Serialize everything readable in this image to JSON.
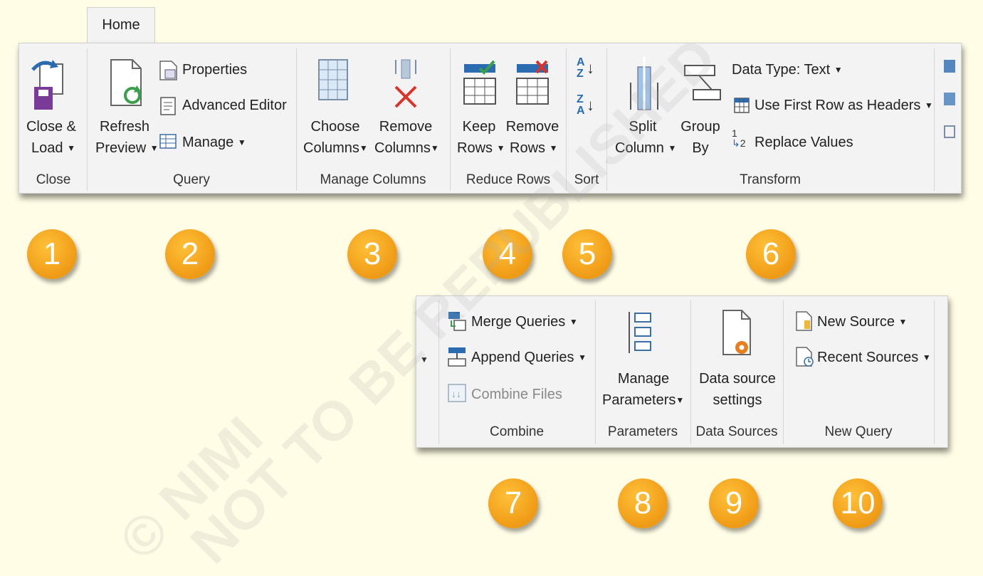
{
  "tab": {
    "label": "Home"
  },
  "close_group": {
    "close_load": [
      "Close &",
      "Load"
    ],
    "label": "Close"
  },
  "query_group": {
    "refresh_preview": [
      "Refresh",
      "Preview"
    ],
    "properties": "Properties",
    "advanced_editor": "Advanced Editor",
    "manage": "Manage",
    "label": "Query"
  },
  "manage_columns_group": {
    "choose_columns": [
      "Choose",
      "Columns"
    ],
    "remove_columns": [
      "Remove",
      "Columns"
    ],
    "label": "Manage Columns"
  },
  "reduce_rows_group": {
    "keep_rows": [
      "Keep",
      "Rows"
    ],
    "remove_rows": [
      "Remove",
      "Rows"
    ],
    "label": "Reduce Rows"
  },
  "sort_group": {
    "label": "Sort"
  },
  "transform_group": {
    "split_column": [
      "Split",
      "Column"
    ],
    "group_by": [
      "Group",
      "By"
    ],
    "data_type": "Data Type: Text",
    "use_first_row": "Use First Row as Headers",
    "replace_values": "Replace Values",
    "label": "Transform"
  },
  "combine_group": {
    "merge_queries": "Merge Queries",
    "append_queries": "Append Queries",
    "combine_files": "Combine Files",
    "label": "Combine"
  },
  "parameters_group": {
    "manage_parameters": [
      "Manage",
      "Parameters"
    ],
    "label": "Parameters"
  },
  "data_sources_group": {
    "data_source_settings": [
      "Data source",
      "settings"
    ],
    "label": "Data Sources"
  },
  "new_query_group": {
    "new_source": "New Source",
    "recent_sources": "Recent Sources",
    "label": "New Query"
  },
  "badges": [
    "1",
    "2",
    "3",
    "4",
    "5",
    "6",
    "7",
    "8",
    "9",
    "10"
  ],
  "watermark": [
    "© NIMI",
    "NOT TO BE REPUBLISHED"
  ],
  "colors": {
    "badge": "#f2a01a",
    "ribbon": "#f3f3f3",
    "background": "#fffde6",
    "accent_blue": "#2b6cb0",
    "accent_red": "#d9342b"
  }
}
